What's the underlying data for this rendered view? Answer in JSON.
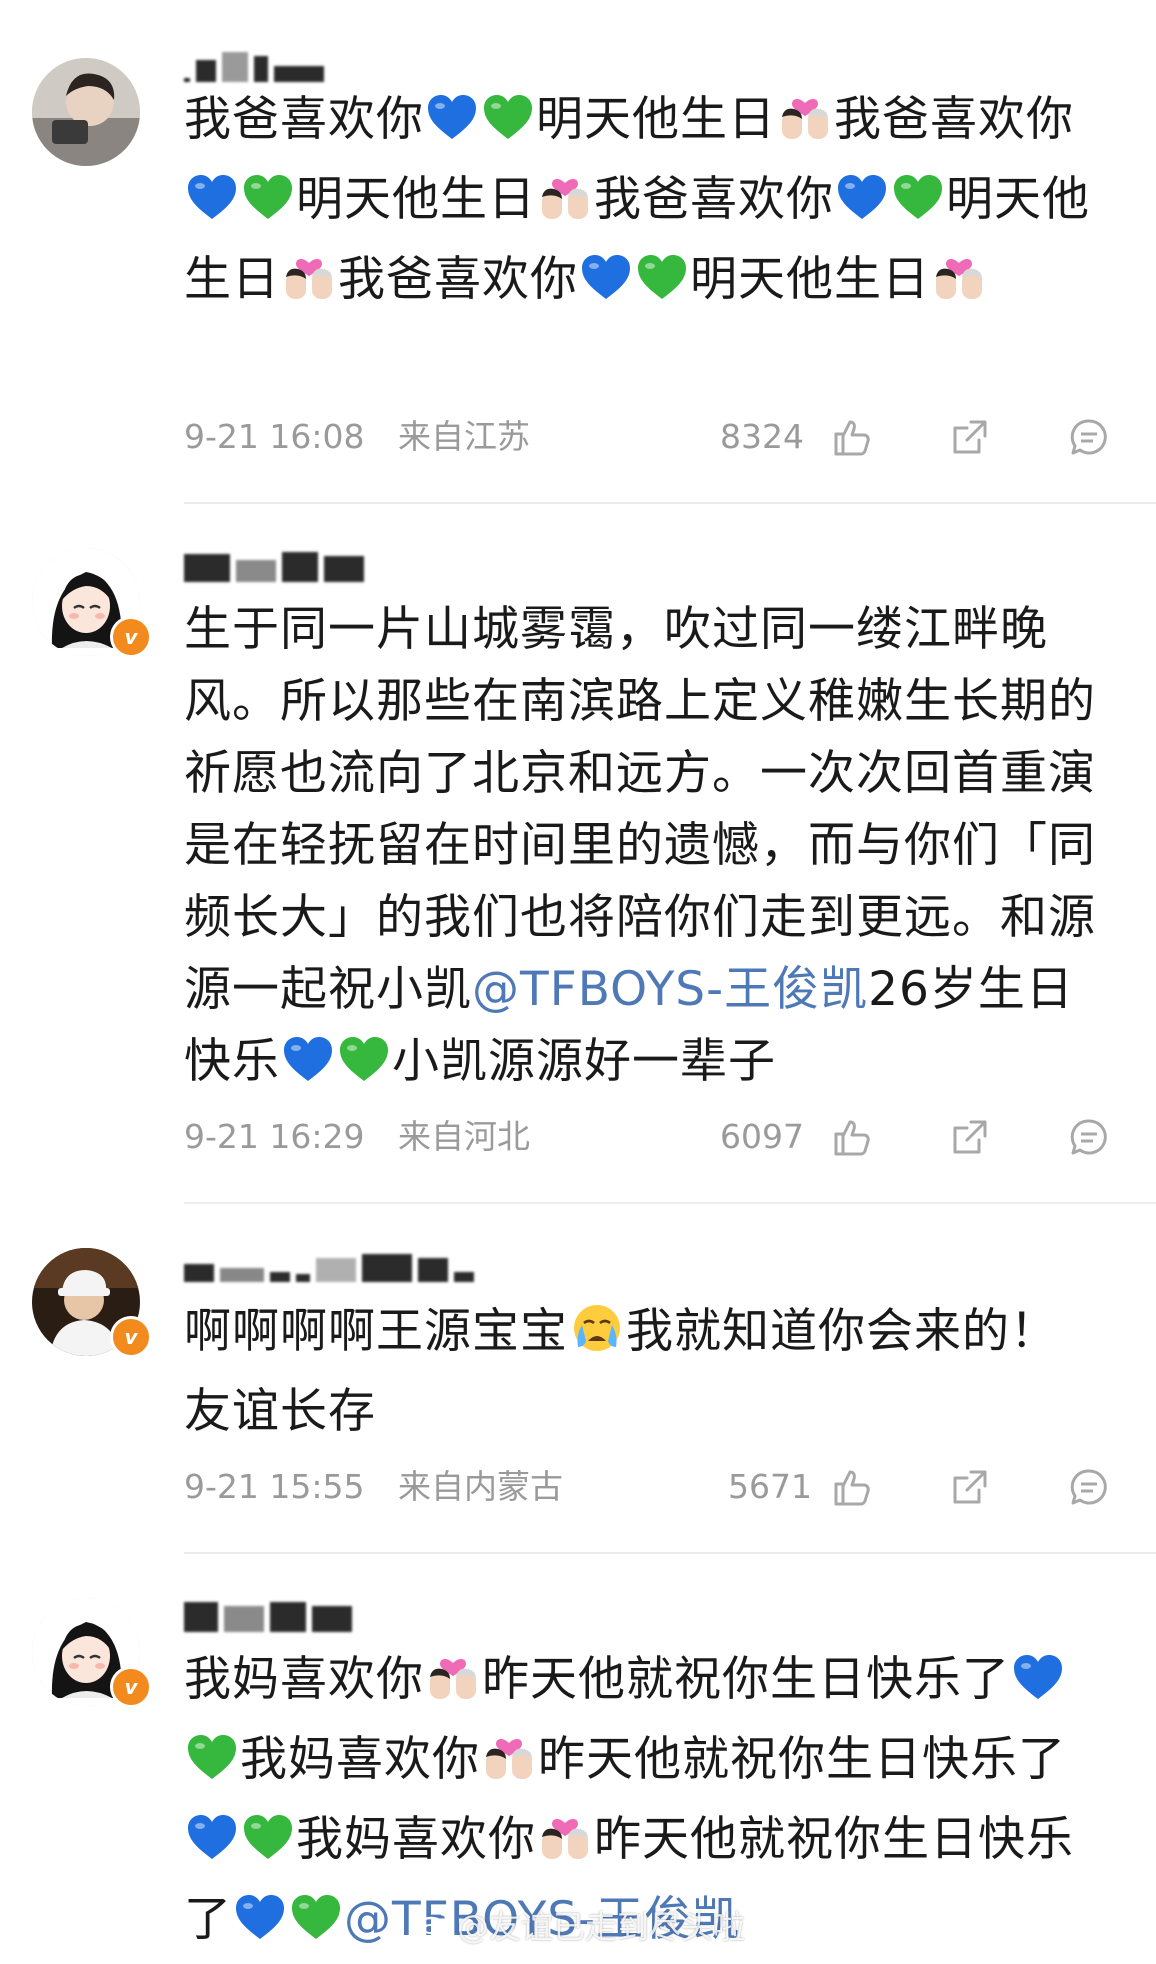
{
  "comments": [
    {
      "text_segments": [
        "我爸喜欢你",
        "blue-heart",
        "green-heart",
        "明天他生日",
        "couple-kiss",
        "我爸喜欢你",
        "blue-heart",
        "green-heart",
        "明天他生日",
        "couple-kiss",
        "我爸喜欢你",
        "blue-heart",
        "green-heart",
        "明天他生日",
        "couple-kiss",
        "我爸喜欢你",
        "blue-heart",
        "green-heart",
        "明天他生日",
        "couple-kiss"
      ],
      "time": "9-21 16:08",
      "location": "来自江苏",
      "likes": "8324"
    },
    {
      "text": "生于同一片山城雾霭，吹过同一缕江畔晚风。所以那些在南滨路上定义稚嫩生长期的祈愿也流向了北京和远方。一次次回首重演是在轻抚留在时间里的遗憾，而与你们「同频长大」的我们也将陪你们走到更远。和源源一起祝小凯",
      "mention": "@TFBOYS-王俊凯",
      "tail": "26岁生日快乐",
      "tail2": "小凯源源好一辈子",
      "time": "9-21 16:29",
      "location": "来自河北",
      "likes": "6097"
    },
    {
      "text": "啊啊啊啊王源宝宝",
      "text2": "我就知道你会来的！友谊长存",
      "time": "9-21 15:55",
      "location": "来自内蒙古",
      "likes": "5671"
    },
    {
      "segments": [
        "我妈喜欢你",
        "couple-kiss",
        "昨天他就祝你生日快乐了",
        "blue-heart",
        "green-heart",
        "我妈喜欢你",
        "couple-kiss",
        "昨天他就祝你生日快乐了",
        "blue-heart",
        "green-heart",
        "我妈喜欢你",
        "couple-kiss",
        "昨天他就祝你生日快乐了",
        "blue-heart",
        "green-heart"
      ],
      "mention": "@TFBOYS-王俊凯"
    }
  ],
  "verified_badge": "v",
  "watermark": "@友谊已走到尽头啦",
  "colors": {
    "text": "#1a1a1a",
    "meta": "#9a9a9a",
    "mention": "#4f79b6",
    "verified": "#f28a1d",
    "blue_heart": "#1f6fe0",
    "green_heart": "#35b83d"
  }
}
